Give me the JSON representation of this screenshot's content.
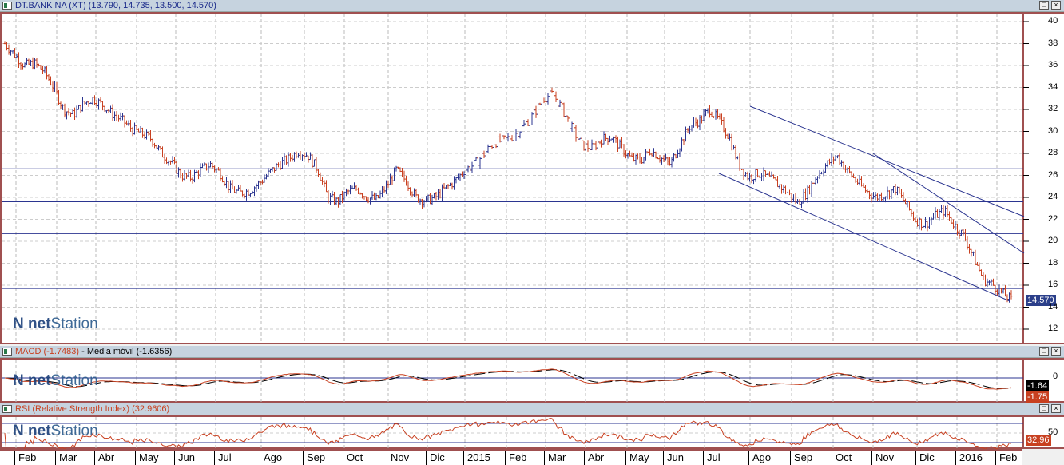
{
  "main": {
    "title": "DT.BANK NA (XT) (13.790, 14.735, 13.500, 14.570)",
    "last_price": "14.570",
    "y_ticks": [
      "40",
      "38",
      "36",
      "34",
      "32",
      "30",
      "28",
      "26",
      "24",
      "22",
      "20",
      "18",
      "16",
      "14",
      "12"
    ]
  },
  "macd": {
    "label": "MACD (-1.7483)",
    "signal_label": "Media móvil (-1.6356)",
    "zero_tick": "0",
    "signal_value": "-1.64",
    "macd_value": "-1.75"
  },
  "rsi": {
    "label": "RSI (Relative Strength Index) (32.9606)",
    "tick_50": "50",
    "value": "32.96"
  },
  "logo": {
    "net": "net",
    "station": "Station"
  },
  "buttons": {
    "maximize": "□",
    "close": "×"
  },
  "x_axis": [
    "Feb",
    "Mar",
    "Abr",
    "May",
    "Jun",
    "Jul",
    "Ago",
    "Sep",
    "Oct",
    "Nov",
    "Dic",
    "2015",
    "Feb",
    "Mar",
    "Abr",
    "May",
    "Jun",
    "Jul",
    "Ago",
    "Sep",
    "Oct",
    "Nov",
    "Dic",
    "2016",
    "Feb"
  ],
  "chart_data": {
    "type": "ohlc",
    "title": "DT.BANK NA (XT)",
    "ylim": [
      11,
      41
    ],
    "horizontal_levels": [
      26.6,
      23.6,
      20.7,
      15.7
    ],
    "weekly_close": [
      38,
      37,
      36,
      36.2,
      35.5,
      34,
      32,
      31.5,
      32.5,
      33,
      32.4,
      31.6,
      31,
      30.2,
      29.8,
      29.3,
      28,
      27.2,
      26,
      25.8,
      26.5,
      27,
      26.2,
      24.8,
      24.4,
      24.6,
      25.3,
      26.2,
      27,
      27.5,
      28.2,
      27.8,
      26.5,
      24,
      23.6,
      24.5,
      24.8,
      24,
      23.8,
      25,
      26.5,
      25.5,
      24,
      23.7,
      24,
      24.8,
      25.5,
      26.5,
      27,
      28,
      29,
      29.2,
      29.6,
      30.5,
      31.5,
      33,
      33.4,
      32,
      30.2,
      28.7,
      28.5,
      29.3,
      29.5,
      28.5,
      27.5,
      27.4,
      28.3,
      27.6,
      27,
      28.8,
      30.5,
      31,
      32,
      31,
      29.5,
      27,
      25.8,
      26.2,
      25.8,
      25.2,
      24.4,
      23.5,
      24.5,
      26,
      27,
      27.8,
      26.5,
      25.5,
      24.6,
      24,
      24.3,
      24.8,
      23.5,
      22,
      21.5,
      22.3,
      22.8,
      21.5,
      20.5,
      18.5,
      16.5,
      16,
      15.2,
      14.57
    ],
    "macd_range": [
      -2.2,
      1.4
    ],
    "rsi_levels": [
      70,
      30
    ]
  }
}
